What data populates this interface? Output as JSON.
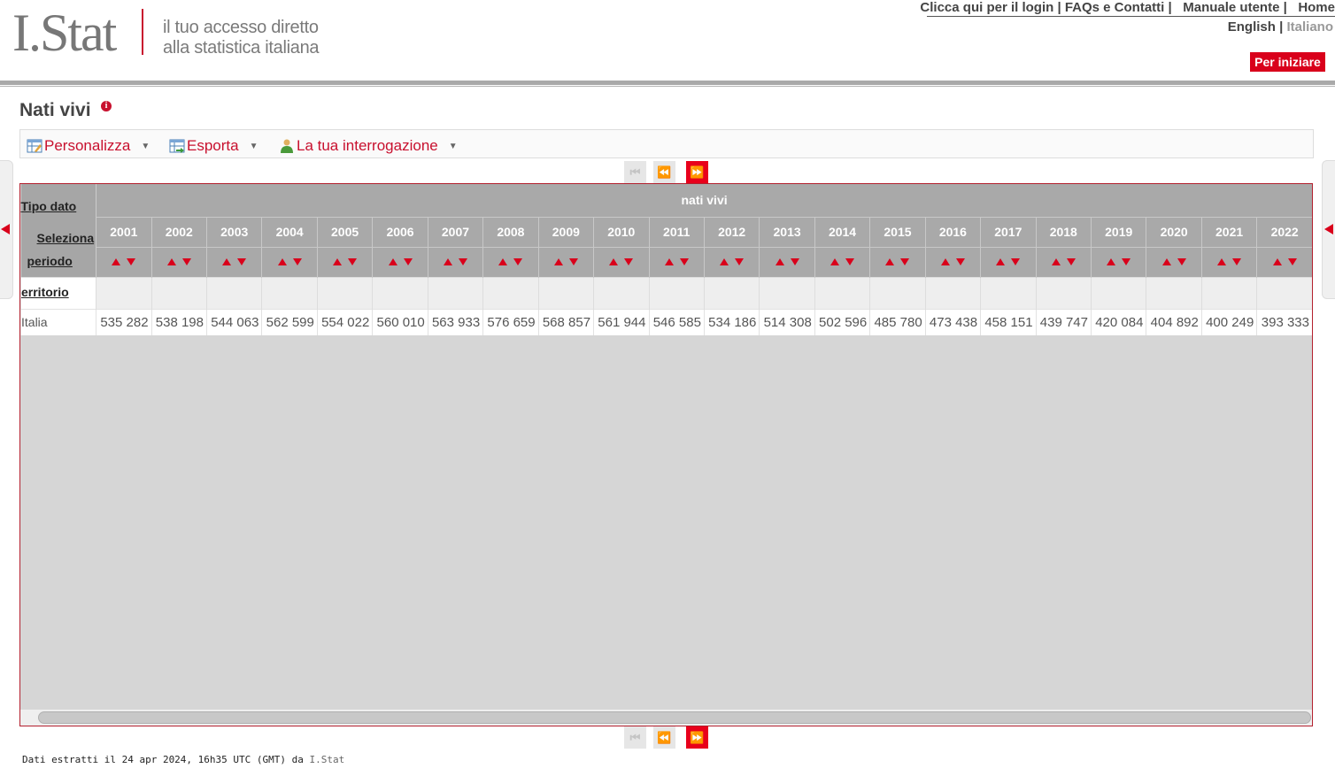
{
  "header": {
    "logo_text": "I.Stat",
    "tagline_1": "il tuo accesso diretto",
    "tagline_2": "alla statistica italiana",
    "links": [
      "Clicca qui per il login",
      "FAQs e Contatti",
      "Manuale utente",
      "Home"
    ],
    "lang_en": "English",
    "lang_it": "Italiano",
    "start_button": "Per iniziare"
  },
  "page": {
    "title": "Nati vivi",
    "info_icon": "i"
  },
  "menu": {
    "personalizza": "Personalizza",
    "esporta": "Esporta",
    "interrogazione": "La tua interrogazione"
  },
  "pager": {
    "first": "⏮",
    "prev": "⏪",
    "next": "⏩"
  },
  "table": {
    "tipo_dato_label": "Tipo dato",
    "seleziona_label": "Seleziona",
    "periodo_label": "periodo",
    "territorio_label": "erritorio",
    "measure": "nati vivi",
    "years": [
      "2001",
      "2002",
      "2003",
      "2004",
      "2005",
      "2006",
      "2007",
      "2008",
      "2009",
      "2010",
      "2011",
      "2012",
      "2013",
      "2014",
      "2015",
      "2016",
      "2017",
      "2018",
      "2019",
      "2020",
      "2021",
      "2022"
    ],
    "rows": [
      {
        "label": "Italia",
        "values": [
          "535 282",
          "538 198",
          "544 063",
          "562 599",
          "554 022",
          "560 010",
          "563 933",
          "576 659",
          "568 857",
          "561 944",
          "546 585",
          "534 186",
          "514 308",
          "502 596",
          "485 780",
          "473 438",
          "458 151",
          "439 747",
          "420 084",
          "404 892",
          "400 249",
          "393 333"
        ]
      }
    ]
  },
  "footer": {
    "text": "Dati estratti il 24 apr 2024, 16h35 UTC (GMT) da ",
    "source": "I.Stat"
  },
  "colors": {
    "accent": "#d9001b",
    "header_gray": "#a9a9a9",
    "grid_bg": "#d6d6d6"
  }
}
